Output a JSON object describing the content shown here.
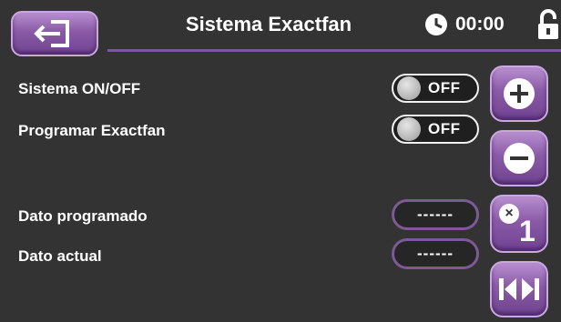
{
  "header": {
    "title": "Sistema Exactfan",
    "time": "00:00",
    "back_icon": "exit-door-icon",
    "clock_icon": "clock-icon",
    "lock_icon": "unlocked-padlock-icon"
  },
  "rows": {
    "system_label": "Sistema ON/OFF",
    "system_toggle": "OFF",
    "program_label": "Programar Exactfan",
    "program_toggle": "OFF",
    "programmed_label": "Dato programado",
    "programmed_value": "------",
    "current_label": "Dato actual",
    "current_value": "------"
  },
  "side_buttons": {
    "multiplier": "1",
    "multiplier_prefix": "×"
  },
  "colors": {
    "accent": "#8a5aa6",
    "background": "#333333"
  }
}
